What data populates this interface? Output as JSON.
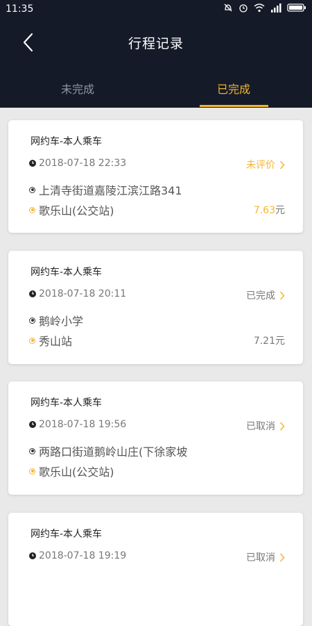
{
  "status_bar": {
    "time": "11:35"
  },
  "header": {
    "title": "行程记录"
  },
  "tabs": [
    {
      "label": "未完成"
    },
    {
      "label": "已完成"
    }
  ],
  "colors": {
    "accent": "#f5b52a",
    "header_bg": "#141a28"
  },
  "trips": [
    {
      "type": "网约车-本人乘车",
      "time": "2018-07-18 22:33",
      "status": "未评价",
      "from": "上清寺街道嘉陵江滨江路341",
      "to": "歌乐山(公交站)",
      "price": "7.63",
      "unit": "元"
    },
    {
      "type": "网约车-本人乘车",
      "time": "2018-07-18 20:11",
      "status": "已完成",
      "from": "鹅岭小学",
      "to": "秀山站",
      "price": "7.21",
      "unit": "元"
    },
    {
      "type": "网约车-本人乘车",
      "time": "2018-07-18 19:56",
      "status": "已取消",
      "from": "两路口街道鹅岭山庄(下徐家坡",
      "to": "歌乐山(公交站)",
      "price": "",
      "unit": ""
    },
    {
      "type": "网约车-本人乘车",
      "time": "2018-07-18 19:19",
      "status": "已取消",
      "from": "",
      "to": "",
      "price": "",
      "unit": ""
    }
  ]
}
